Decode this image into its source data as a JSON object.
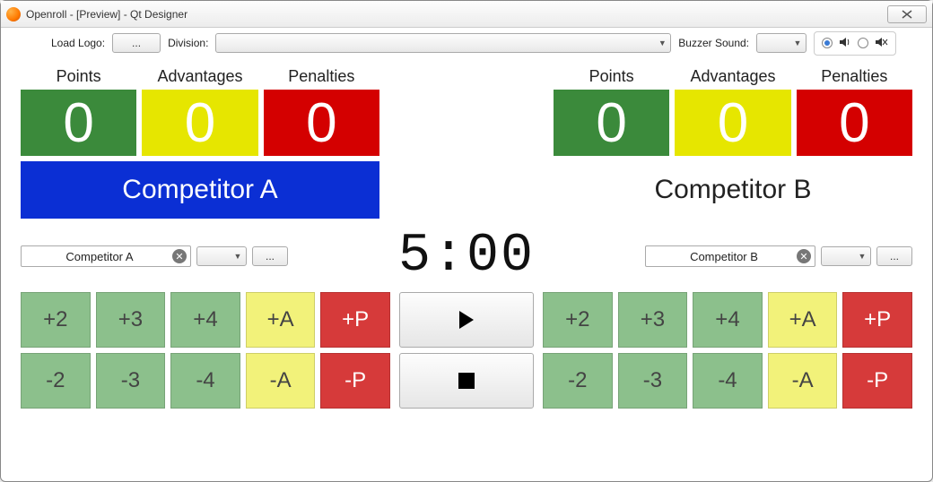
{
  "window": {
    "title": "Openroll - [Preview] - Qt Designer"
  },
  "toolbar": {
    "load_logo_label": "Load Logo:",
    "load_logo_btn": "...",
    "division_label": "Division:",
    "division_value": "",
    "buzzer_label": "Buzzer Sound:",
    "buzzer_value": "",
    "sound_on_checked": true
  },
  "headers": {
    "points": "Points",
    "advantages": "Advantages",
    "penalties": "Penalties"
  },
  "competitorA": {
    "name_display": "Competitor A",
    "name_input": "Competitor A",
    "points": "0",
    "advantages": "0",
    "penalties": "0",
    "color_name": "blue"
  },
  "competitorB": {
    "name_display": "Competitor B",
    "name_input": "Competitor B",
    "points": "0",
    "advantages": "0",
    "penalties": "0",
    "color_name": "white"
  },
  "timer": "5:00",
  "ops": {
    "plus2": "+2",
    "plus3": "+3",
    "plus4": "+4",
    "plusA": "+A",
    "plusP": "+P",
    "minus2": "-2",
    "minus3": "-3",
    "minus4": "-4",
    "minusA": "-A",
    "minusP": "-P"
  },
  "controls": {
    "ellipsis": "...",
    "dropdown_value": ""
  }
}
